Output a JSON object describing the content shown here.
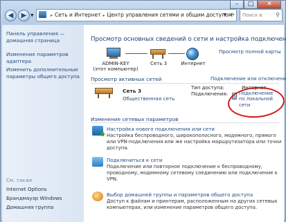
{
  "window": {
    "buttons": {
      "minimize": "–",
      "maximize": "□",
      "close": "✕"
    }
  },
  "nav": {
    "back_glyph": "◀",
    "forward_glyph": "▶",
    "address": {
      "crumbs": [
        "Сеть и Интернет",
        "Центр управления сетями и общим доступом"
      ],
      "separator": "▸"
    },
    "search_placeholder": "Поиск в панели управления"
  },
  "left_pane": {
    "links": [
      "Панель управления — домашняя страница",
      "Изменение параметров адаптера",
      "Изменить дополнительные параметры общего доступа"
    ],
    "see_also_label": "См. также",
    "see_also": [
      "Internet Options",
      "Брандмауэр Windows",
      "Домашняя группа"
    ]
  },
  "main": {
    "heading": "Просмотр основных сведений о сети и настройка подключений",
    "full_map_link": "Просмотр полной карты",
    "map": {
      "computer_name": "ADMIN-KEY",
      "computer_sub": "(этот компьютер)",
      "network_name": "Сеть 3",
      "internet_label": "Интернет"
    },
    "active_networks_heading": "Просмотр активных сетей",
    "connect_disconnect_link": "Подключение или отключение",
    "network": {
      "name": "Сеть 3",
      "type": "Общественная сеть",
      "access_type_label": "Тип доступа:",
      "access_type_value": "Интернет",
      "connections_label": "Подключения:",
      "connection_link": "Подключение по локальной сети"
    },
    "change_settings_heading": "Изменение сетевых параметров",
    "tasks": [
      {
        "icon": "new-connection-icon",
        "title": "Настройка нового подключения или сети",
        "desc": "Настройка беспроводного, широкополосного, модемного, прямого или VPN-подключения или же настройка маршрутизатора или точки доступа."
      },
      {
        "icon": "connect-network-icon",
        "title": "Подключиться к сети",
        "desc": "Подключение или повторное подключение к беспроводному, проводному, модемному сетевому соединению или подключение к VPN."
      },
      {
        "icon": "homegroup-icon",
        "title": "Выбор домашней группы и параметров общего доступа",
        "desc": "Доступ к файлам и принтерам, расположенным на других сетевых компьютерах, или изменение параметров общего доступа."
      }
    ]
  },
  "colors": {
    "link": "#1f4a85",
    "heading": "#1c3f73",
    "annotation_red": "#d01818"
  }
}
